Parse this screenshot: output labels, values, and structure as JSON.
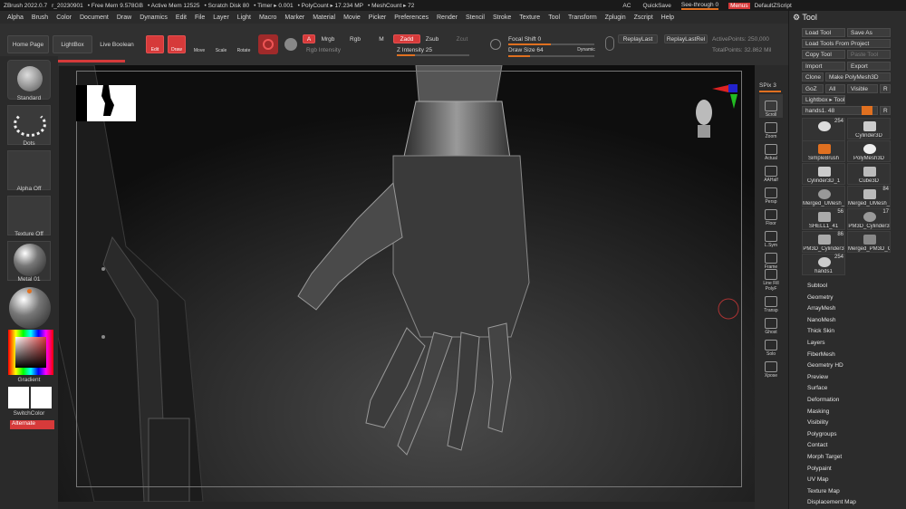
{
  "titlebar": {
    "app": "ZBrush 2022.0.7",
    "build": "r_20230901",
    "free_mem": "• Free Mem 9.578GB",
    "active_mem": "• Active Mem 12525",
    "scratch": "• Scratch Disk 80",
    "timer": "• Timer ▸ 0.001",
    "polycount": "• PolyCount ▸ 17.234 MP",
    "meshcount": "• MeshCount ▸ 72",
    "ac": "AC",
    "quicksave": "QuickSave",
    "seethrough": "See-through  0",
    "menus": "Menus",
    "script": "DefaultZScript"
  },
  "menubar": [
    "Alpha",
    "Brush",
    "Color",
    "Document",
    "Draw",
    "Dynamics",
    "Edit",
    "File",
    "Layer",
    "Light",
    "Macro",
    "Marker",
    "Material",
    "Movie",
    "Picker",
    "Preferences",
    "Render",
    "Stencil",
    "Stroke",
    "Texture",
    "Tool",
    "Transform",
    "Zplugin",
    "Zscript",
    "Help"
  ],
  "shelf": {
    "home": "Home Page",
    "lightbox": "LightBox",
    "liveboolean": "Live Boolean",
    "edit": "Edit",
    "draw": "Draw",
    "move": "Move",
    "scale": "Scale",
    "rotate": "Rotate",
    "a": "A",
    "mrgb": "Mrgb",
    "rgb": "Rgb",
    "m": "M",
    "zadd": "Zadd",
    "zsub": "Zsub",
    "zcut": "Zcut",
    "rgb_intensity": "Rgb Intensity",
    "z_intensity": "Z Intensity 25",
    "focal_shift": "Focal Shift 0",
    "draw_size": "Draw Size 64",
    "dynamic": "Dynamic",
    "replay_last": "ReplayLast",
    "replay_last_rel": "ReplayLastRel",
    "active_points": "ActivePoints: 250,000",
    "total_points": "TotalPoints: 32.862 Mil",
    "z_intensity_value": 25,
    "draw_size_value": 64
  },
  "lefttray": {
    "brush": "Standard",
    "stroke": "Dots",
    "alpha": "Alpha Off",
    "texture": "Texture Off",
    "material": "Metal 01",
    "gradient": "Gradient",
    "switchcolor": "SwitchColor",
    "alternate": "Alternate"
  },
  "rightcol": {
    "spix_label": "SPix",
    "spix_value": "3",
    "icons": [
      {
        "label": "Scroll"
      },
      {
        "label": "Zoom"
      },
      {
        "label": "Actual"
      },
      {
        "label": "AAHalf"
      },
      {
        "label": "Persp"
      },
      {
        "label": "Floor"
      },
      {
        "label": "L.Sym"
      },
      {
        "label": "Frame"
      },
      {
        "label": "Line Fill PolyF"
      },
      {
        "label": "Transp"
      },
      {
        "label": "Ghost"
      },
      {
        "label": "Solo"
      },
      {
        "label": "Xpose"
      }
    ]
  },
  "tool": {
    "title": "Tool",
    "buttons": [
      "Load Tool",
      "Save As",
      "Load Tools From Project",
      "Copy Tool",
      "Paste Tool",
      "Import",
      "Export",
      "Clone",
      "Make PolyMesh3D",
      "GoZ",
      "All",
      "Visible",
      "R",
      "Lightbox ▸ Tools",
      "R"
    ],
    "current": "hands1. 48",
    "items": [
      {
        "label": "hands1",
        "num": "254"
      },
      {
        "label": "Cylinder3D",
        "num": ""
      },
      {
        "label": "SimpleBrush",
        "num": ""
      },
      {
        "label": "PolyMesh3D",
        "num": ""
      },
      {
        "label": "Cylinder3D_1",
        "num": ""
      },
      {
        "label": "Cube3D",
        "num": ""
      },
      {
        "label": "Merged_UMesh_",
        "num": ""
      },
      {
        "label": "Merged_UMesh_",
        "num": "84"
      },
      {
        "label": "SHELL1_41",
        "num": "56"
      },
      {
        "label": "PM3D_Cylinder3",
        "num": "17"
      },
      {
        "label": "PM3D_Cylinder3",
        "num": "86"
      },
      {
        "label": "Merged_PM3D_C",
        "num": ""
      },
      {
        "label": "hands1",
        "num": "254"
      }
    ],
    "subpalettes": [
      "Subtool",
      "Geometry",
      "ArrayMesh",
      "NanoMesh",
      "Thick Skin",
      "Layers",
      "FiberMesh",
      "Geometry HD",
      "Preview",
      "Surface",
      "Deformation",
      "Masking",
      "Visibility",
      "Polygroups",
      "Contact",
      "Morph Target",
      "Polypaint",
      "UV Map",
      "Texture Map",
      "Displacement Map"
    ]
  },
  "colors": {
    "accent": "#e07020",
    "red": "#d63a3a",
    "canvas": "#111111"
  }
}
